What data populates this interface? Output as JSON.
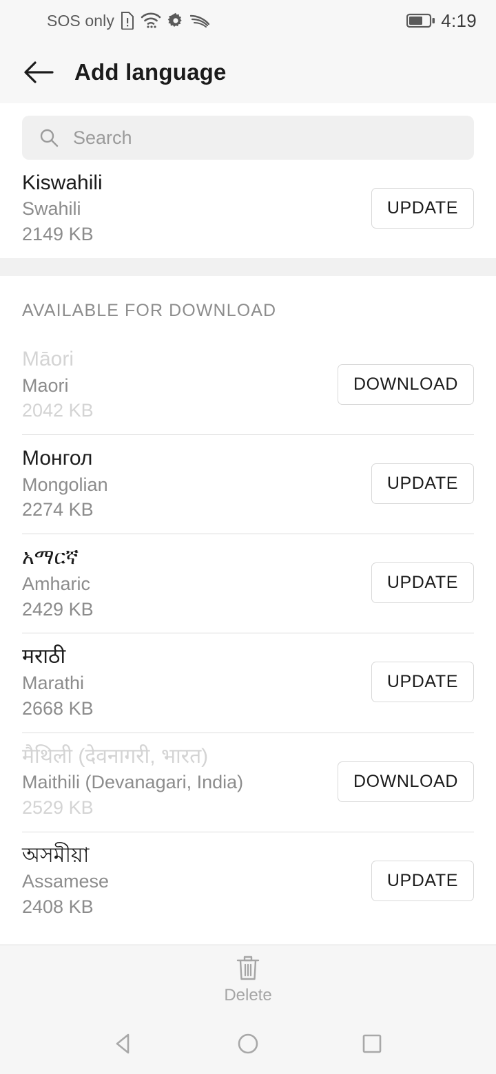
{
  "statusbar": {
    "carrier": "SOS only",
    "time": "4:19",
    "icons": [
      "sim-alert-icon",
      "wifi-icon",
      "gear-icon",
      "swoosh-icon",
      "battery-icon"
    ],
    "battery_level_percent": 62
  },
  "appbar": {
    "back_icon": "back-arrow-icon",
    "title": "Add language"
  },
  "search": {
    "icon": "search-icon",
    "placeholder": "Search",
    "value": ""
  },
  "installed": {
    "items": [
      {
        "native": "Kiswahili",
        "english": "Swahili",
        "size": "2149 KB",
        "action": "UPDATE",
        "dimmed": false
      }
    ]
  },
  "available": {
    "header": "AVAILABLE FOR DOWNLOAD",
    "items": [
      {
        "native": "Māori",
        "english": "Maori",
        "size": "2042 KB",
        "action": "DOWNLOAD",
        "dimmed": true
      },
      {
        "native": "Монгол",
        "english": "Mongolian",
        "size": "2274 KB",
        "action": "UPDATE",
        "dimmed": false
      },
      {
        "native": "አማርኛ",
        "english": "Amharic",
        "size": "2429 KB",
        "action": "UPDATE",
        "dimmed": false
      },
      {
        "native": "मराठी",
        "english": "Marathi",
        "size": "2668 KB",
        "action": "UPDATE",
        "dimmed": false
      },
      {
        "native": "मैथिली (देवनागरी, भारत)",
        "english": "Maithili (Devanagari, India)",
        "size": "2529 KB",
        "action": "DOWNLOAD",
        "dimmed": true
      },
      {
        "native": "অসমীয়া",
        "english": "Assamese",
        "size": "2408 KB",
        "action": "UPDATE",
        "dimmed": false
      }
    ]
  },
  "bottombar": {
    "icon": "trash-icon",
    "label": "Delete",
    "enabled": false
  },
  "navbar": {
    "back": "nav-back-icon",
    "home": "nav-home-icon",
    "recents": "nav-recents-icon"
  },
  "colors": {
    "header_bg": "#f7f7f7",
    "content_bg": "#ffffff",
    "divider": "#dcdcdc",
    "primary_text": "#1c1c1c",
    "secondary_text": "#8c8c8c",
    "dim_text": "#d4d4d4",
    "search_bg": "#f0f0f0"
  }
}
